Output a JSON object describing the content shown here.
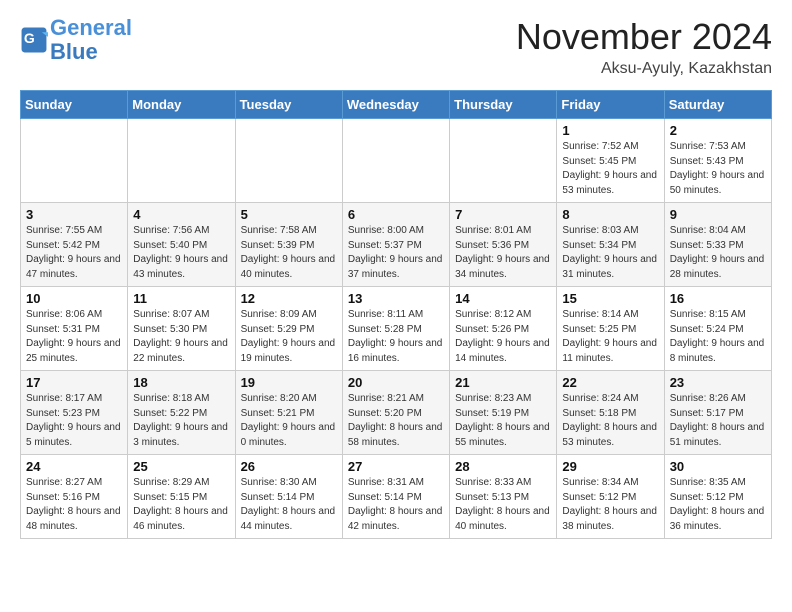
{
  "logo": {
    "line1": "General",
    "line2": "Blue"
  },
  "title": "November 2024",
  "location": "Aksu-Ayuly, Kazakhstan",
  "headers": [
    "Sunday",
    "Monday",
    "Tuesday",
    "Wednesday",
    "Thursday",
    "Friday",
    "Saturday"
  ],
  "weeks": [
    [
      {
        "day": "",
        "info": ""
      },
      {
        "day": "",
        "info": ""
      },
      {
        "day": "",
        "info": ""
      },
      {
        "day": "",
        "info": ""
      },
      {
        "day": "",
        "info": ""
      },
      {
        "day": "1",
        "info": "Sunrise: 7:52 AM\nSunset: 5:45 PM\nDaylight: 9 hours and 53 minutes."
      },
      {
        "day": "2",
        "info": "Sunrise: 7:53 AM\nSunset: 5:43 PM\nDaylight: 9 hours and 50 minutes."
      }
    ],
    [
      {
        "day": "3",
        "info": "Sunrise: 7:55 AM\nSunset: 5:42 PM\nDaylight: 9 hours and 47 minutes."
      },
      {
        "day": "4",
        "info": "Sunrise: 7:56 AM\nSunset: 5:40 PM\nDaylight: 9 hours and 43 minutes."
      },
      {
        "day": "5",
        "info": "Sunrise: 7:58 AM\nSunset: 5:39 PM\nDaylight: 9 hours and 40 minutes."
      },
      {
        "day": "6",
        "info": "Sunrise: 8:00 AM\nSunset: 5:37 PM\nDaylight: 9 hours and 37 minutes."
      },
      {
        "day": "7",
        "info": "Sunrise: 8:01 AM\nSunset: 5:36 PM\nDaylight: 9 hours and 34 minutes."
      },
      {
        "day": "8",
        "info": "Sunrise: 8:03 AM\nSunset: 5:34 PM\nDaylight: 9 hours and 31 minutes."
      },
      {
        "day": "9",
        "info": "Sunrise: 8:04 AM\nSunset: 5:33 PM\nDaylight: 9 hours and 28 minutes."
      }
    ],
    [
      {
        "day": "10",
        "info": "Sunrise: 8:06 AM\nSunset: 5:31 PM\nDaylight: 9 hours and 25 minutes."
      },
      {
        "day": "11",
        "info": "Sunrise: 8:07 AM\nSunset: 5:30 PM\nDaylight: 9 hours and 22 minutes."
      },
      {
        "day": "12",
        "info": "Sunrise: 8:09 AM\nSunset: 5:29 PM\nDaylight: 9 hours and 19 minutes."
      },
      {
        "day": "13",
        "info": "Sunrise: 8:11 AM\nSunset: 5:28 PM\nDaylight: 9 hours and 16 minutes."
      },
      {
        "day": "14",
        "info": "Sunrise: 8:12 AM\nSunset: 5:26 PM\nDaylight: 9 hours and 14 minutes."
      },
      {
        "day": "15",
        "info": "Sunrise: 8:14 AM\nSunset: 5:25 PM\nDaylight: 9 hours and 11 minutes."
      },
      {
        "day": "16",
        "info": "Sunrise: 8:15 AM\nSunset: 5:24 PM\nDaylight: 9 hours and 8 minutes."
      }
    ],
    [
      {
        "day": "17",
        "info": "Sunrise: 8:17 AM\nSunset: 5:23 PM\nDaylight: 9 hours and 5 minutes."
      },
      {
        "day": "18",
        "info": "Sunrise: 8:18 AM\nSunset: 5:22 PM\nDaylight: 9 hours and 3 minutes."
      },
      {
        "day": "19",
        "info": "Sunrise: 8:20 AM\nSunset: 5:21 PM\nDaylight: 9 hours and 0 minutes."
      },
      {
        "day": "20",
        "info": "Sunrise: 8:21 AM\nSunset: 5:20 PM\nDaylight: 8 hours and 58 minutes."
      },
      {
        "day": "21",
        "info": "Sunrise: 8:23 AM\nSunset: 5:19 PM\nDaylight: 8 hours and 55 minutes."
      },
      {
        "day": "22",
        "info": "Sunrise: 8:24 AM\nSunset: 5:18 PM\nDaylight: 8 hours and 53 minutes."
      },
      {
        "day": "23",
        "info": "Sunrise: 8:26 AM\nSunset: 5:17 PM\nDaylight: 8 hours and 51 minutes."
      }
    ],
    [
      {
        "day": "24",
        "info": "Sunrise: 8:27 AM\nSunset: 5:16 PM\nDaylight: 8 hours and 48 minutes."
      },
      {
        "day": "25",
        "info": "Sunrise: 8:29 AM\nSunset: 5:15 PM\nDaylight: 8 hours and 46 minutes."
      },
      {
        "day": "26",
        "info": "Sunrise: 8:30 AM\nSunset: 5:14 PM\nDaylight: 8 hours and 44 minutes."
      },
      {
        "day": "27",
        "info": "Sunrise: 8:31 AM\nSunset: 5:14 PM\nDaylight: 8 hours and 42 minutes."
      },
      {
        "day": "28",
        "info": "Sunrise: 8:33 AM\nSunset: 5:13 PM\nDaylight: 8 hours and 40 minutes."
      },
      {
        "day": "29",
        "info": "Sunrise: 8:34 AM\nSunset: 5:12 PM\nDaylight: 8 hours and 38 minutes."
      },
      {
        "day": "30",
        "info": "Sunrise: 8:35 AM\nSunset: 5:12 PM\nDaylight: 8 hours and 36 minutes."
      }
    ]
  ]
}
